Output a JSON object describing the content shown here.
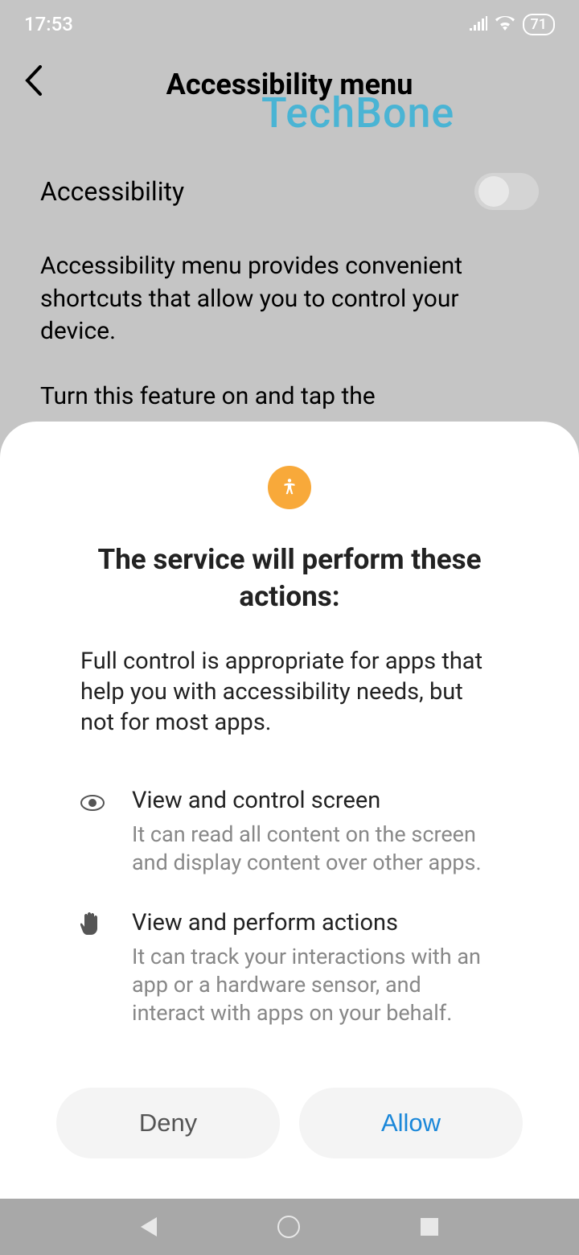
{
  "status": {
    "time": "17:53",
    "battery": "71"
  },
  "header": {
    "title": "Accessibility menu"
  },
  "watermark": "TechBone",
  "setting": {
    "label": "Accessibility"
  },
  "desc1": "Accessibility menu provides convenient shortcuts that allow you to control your device.",
  "desc2": "Turn this feature on and tap the",
  "modal": {
    "title": "The service will perform these actions:",
    "subtitle": "Full control is appropriate for apps that help you with accessibility needs, but not for most apps.",
    "perm1": {
      "title": "View and control screen",
      "desc": "It can read all content on the screen and display content over other apps."
    },
    "perm2": {
      "title": "View and perform actions",
      "desc": "It can track your interactions with an app or a hardware sensor, and interact with apps on your behalf."
    },
    "deny": "Deny",
    "allow": "Allow"
  }
}
